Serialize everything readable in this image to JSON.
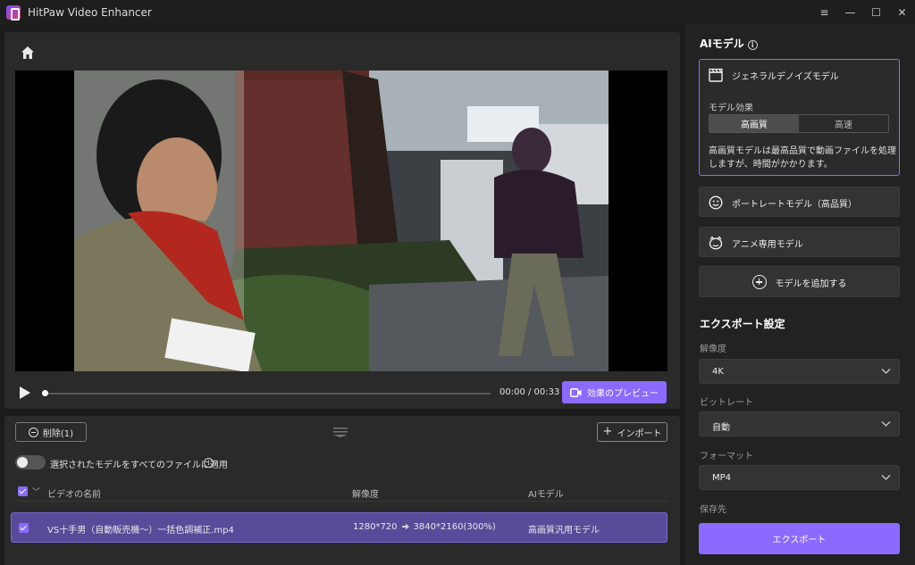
{
  "window": {
    "title": "HitPaw Video Enhancer",
    "controls": [
      "≡",
      "—",
      "☐",
      "✕"
    ]
  },
  "player": {
    "time": "00:00 / 00:33",
    "progress": 0,
    "preview_button": "効果のプレビュー"
  },
  "file_list": {
    "delete_button": "削除(1)",
    "import_button": "インポート",
    "apply_all_label": "選択されたモデルをすべてのファイルに適用",
    "apply_all_enabled": false,
    "columns": {
      "name": "ビデオの名前",
      "resolution": "解像度",
      "model": "AIモデル"
    },
    "rows": [
      {
        "checked": true,
        "name": "VS十手男（自動販売機〜）一括色調補正.mp4",
        "resolution_from": "1280*720",
        "resolution_to": "3840*2160(300%)",
        "model": "高画質汎用モデル"
      }
    ]
  },
  "side": {
    "ai_model_title": "AIモデル",
    "models": [
      {
        "icon": "clapperboard-icon",
        "label": "ジェネラルデノイズモデル",
        "selected": true
      },
      {
        "icon": "face-icon",
        "label": "ポートレートモデル（高品質）",
        "selected": false
      },
      {
        "icon": "anime-face-icon",
        "label": "アニメ専用モデル",
        "selected": false
      }
    ],
    "effect_label": "モデル効果",
    "effect_options": [
      "高画質",
      "高速"
    ],
    "effect_selected": "高画質",
    "description": "高画質モデルは最高品質で動画ファイルを処理しますが、時間がかかります。",
    "add_model_label": "モデルを追加する",
    "export_settings_title": "エクスポート設定",
    "resolution_label": "解像度",
    "resolution_value": "4K",
    "bitrate_label": "ビットレート",
    "bitrate_value": "自動",
    "format_label": "フォーマット",
    "format_value": "MP4",
    "save_to_label": "保存先",
    "export_button": "エクスポート"
  },
  "colors": {
    "accent": "#8b6bff",
    "row_selected": "#594a9a",
    "panel": "#2a2a2a",
    "background": "#1b1b1b"
  }
}
